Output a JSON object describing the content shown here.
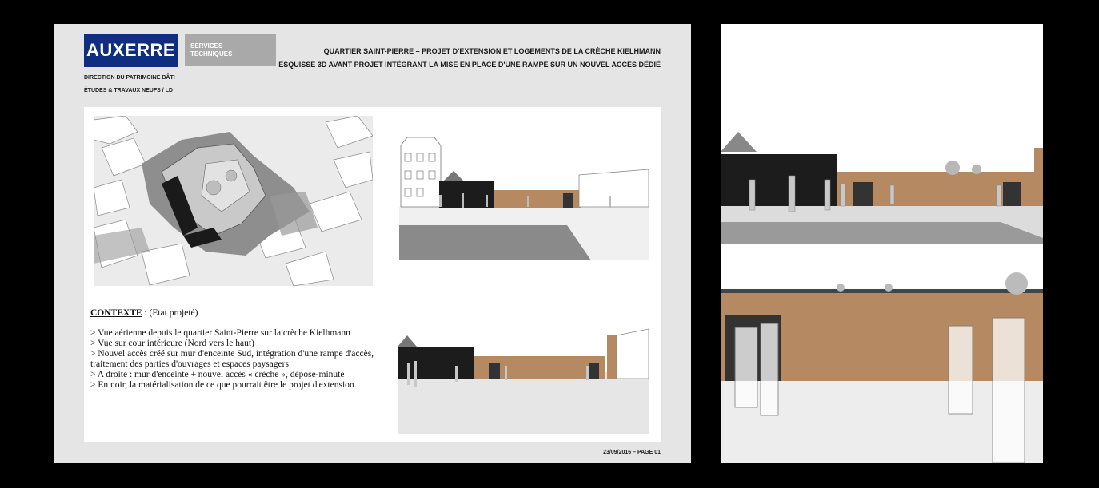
{
  "header": {
    "logo": "AUXERRE",
    "services_line1": "SERVICES",
    "services_line2": "TECHNIQUES",
    "dept_line1": "DIRECTION DU PATRIMOINE BÂTI",
    "dept_line2": "ÉTUDES & TRAVAUX NEUFS / LD",
    "title_line1": "QUARTIER SAINT-PIERRE – PROJET D'EXTENSION ET LOGEMENTS DE LA CRÈCHE KIELHMANN",
    "title_line2": "ESQUISSE 3D AVANT PROJET INTÉGRANT LA MISE EN PLACE D'UNE RAMPE SUR UN NOUVEL ACCÈS DÉDIÉ"
  },
  "contexte": {
    "heading": "CONTEXTE",
    "heading_suffix": " : (Etat projeté)",
    "lines": [
      "> Vue aérienne depuis  le quartier Saint-Pierre sur la crèche Kielhmann",
      "> Vue sur cour intérieure (Nord vers le haut)",
      "> Nouvel accès créé sur mur d'enceinte Sud, intégration d'une rampe d'accès, traitement des parties d'ouvrages et espaces paysagers",
      "> A droite : mur d'enceinte + nouvel accès « crèche », dépose-minute",
      "> En noir, la matérialisation de ce que pourrait être le projet d'extension."
    ]
  },
  "footer": {
    "date_page": "23/09/2016 – PAGE 01"
  },
  "colors": {
    "brand_blue": "#0f2e80",
    "services_gray": "#a9a9a9",
    "sheet_bg": "#e5e5e5",
    "stone_wall": "#b58a62",
    "extension_black": "#1c1c1c"
  }
}
